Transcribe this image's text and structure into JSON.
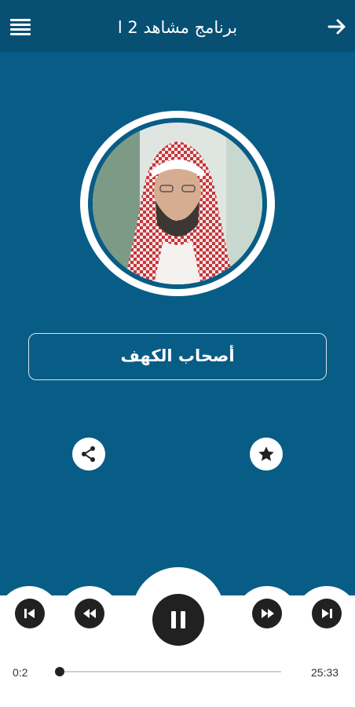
{
  "appbar": {
    "title": "برنامج مشاهد 2 ا",
    "menu_icon": "hamburger-menu-icon",
    "back_icon": "arrow-right-icon"
  },
  "track": {
    "title": "أصحاب الكهف"
  },
  "actions": {
    "share_icon": "share-icon",
    "favorite_icon": "star-icon"
  },
  "player": {
    "current_time": "0:2",
    "total_time": "25:33",
    "progress": 0.0013,
    "state": "playing"
  },
  "colors": {
    "background": "#085d86",
    "appbar": "#074f73",
    "controls": "#212121"
  }
}
